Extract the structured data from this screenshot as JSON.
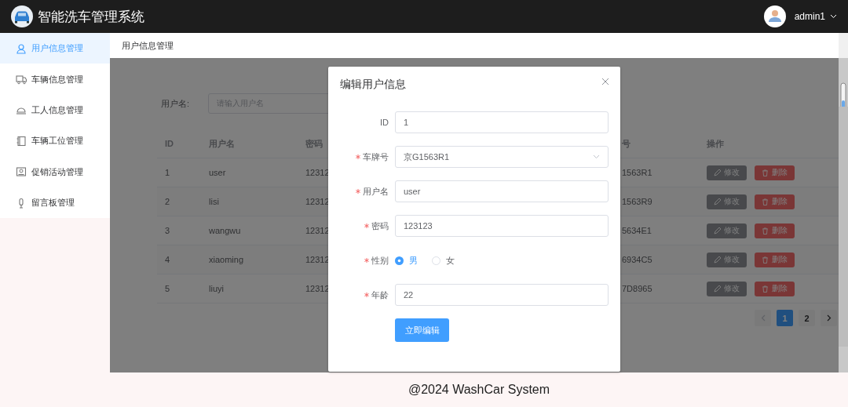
{
  "header": {
    "title": "智能洗车管理系统",
    "user": "admin1"
  },
  "sidebar": {
    "items": [
      {
        "label": "用户信息管理",
        "selected": true
      },
      {
        "label": "车辆信息管理",
        "selected": false
      },
      {
        "label": "工人信息管理",
        "selected": false
      },
      {
        "label": "车辆工位管理",
        "selected": false
      },
      {
        "label": "促销活动管理",
        "selected": false
      },
      {
        "label": "留言板管理",
        "selected": false
      }
    ]
  },
  "breadcrumb": "用户信息管理",
  "search": {
    "label": "用户名:",
    "placeholder": "请输入用户名"
  },
  "table": {
    "columns": [
      "ID",
      "用户名",
      "密码",
      "号",
      "操作"
    ],
    "rows": [
      {
        "id": "1",
        "username": "user",
        "password": "12312",
        "plate": "1563R1",
        "edit": "修改",
        "delete": "删除"
      },
      {
        "id": "2",
        "username": "lisi",
        "password": "12312",
        "plate": "1563R9",
        "edit": "修改",
        "delete": "删除"
      },
      {
        "id": "3",
        "username": "wangwu",
        "password": "12312",
        "plate": "5634E1",
        "edit": "修改",
        "delete": "删除"
      },
      {
        "id": "4",
        "username": "xiaoming",
        "password": "12312",
        "plate": "6934C5",
        "edit": "修改",
        "delete": "删除"
      },
      {
        "id": "5",
        "username": "liuyi",
        "password": "12312",
        "plate": "7D8965",
        "edit": "修改",
        "delete": "删除"
      }
    ]
  },
  "pagination": {
    "pages": [
      {
        "label": "1",
        "selected": true
      },
      {
        "label": "2",
        "selected": false
      }
    ]
  },
  "dialog": {
    "title": "编辑用户信息",
    "fields": [
      {
        "kind": "text",
        "label": "ID",
        "required": false,
        "value": "1"
      },
      {
        "kind": "select",
        "label": "车牌号",
        "required": true,
        "value": "京G1563R1"
      },
      {
        "kind": "text",
        "label": "用户名",
        "required": true,
        "value": "user"
      },
      {
        "kind": "text",
        "label": "密码",
        "required": true,
        "value": "123123"
      },
      {
        "kind": "radio",
        "label": "性别",
        "required": true,
        "options": [
          {
            "label": "男",
            "selected": true
          },
          {
            "label": "女",
            "selected": false
          }
        ]
      },
      {
        "kind": "text",
        "label": "年龄",
        "required": true,
        "value": "22"
      }
    ],
    "submit": "立即编辑"
  },
  "footer": "@2024 WashCar System"
}
